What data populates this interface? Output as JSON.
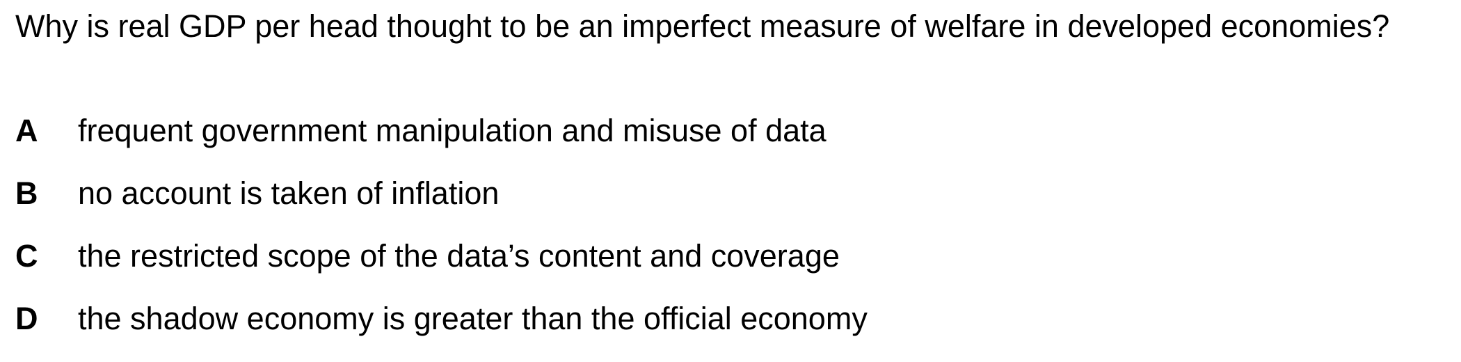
{
  "question": {
    "text": "Why is real GDP per head thought to be an imperfect measure of welfare in developed economies?"
  },
  "options": [
    {
      "letter": "A",
      "text": "frequent government manipulation and misuse of data"
    },
    {
      "letter": "B",
      "text": "no account is taken of inflation"
    },
    {
      "letter": "C",
      "text": "the restricted scope of the data’s content and coverage"
    },
    {
      "letter": "D",
      "text": "the shadow economy is greater than the official economy"
    }
  ]
}
